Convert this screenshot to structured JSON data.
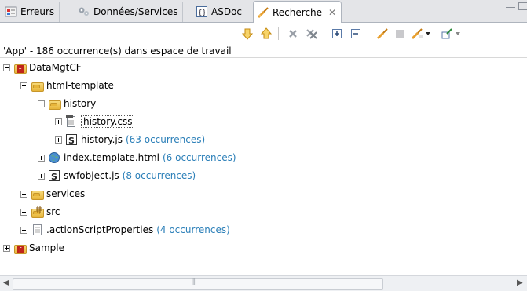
{
  "tabs": [
    {
      "label": "Erreurs",
      "icon": "problems-icon"
    },
    {
      "label": "Données/Services",
      "icon": "data-services-icon"
    },
    {
      "label": "ASDoc",
      "icon": "asdoc-icon"
    },
    {
      "label": "Recherche",
      "icon": "search-icon",
      "active": true
    }
  ],
  "tab_close": "✕",
  "status": "'App' - 186 occurrence(s) dans espace de travail",
  "tree": {
    "root1": "DataMgtCF",
    "html_template": "html-template",
    "history": "history",
    "history_css": "history.css",
    "history_js": "history.js",
    "history_js_count": "(63 occurrences)",
    "index_html": "index.template.html",
    "index_html_count": "(6 occurrences)",
    "swfobject": "swfobject.js",
    "swfobject_count": "(8 occurrences)",
    "services": "services",
    "src": "src",
    "as_props": ".actionScriptProperties",
    "as_props_count": "(4 occurrences)",
    "root2": "Sample"
  },
  "colors": {
    "count_text": "#2b7fb8",
    "tab_bar": "#e4e5e8",
    "accent_orange": "#e8a030",
    "flex_red": "#c0241a"
  }
}
